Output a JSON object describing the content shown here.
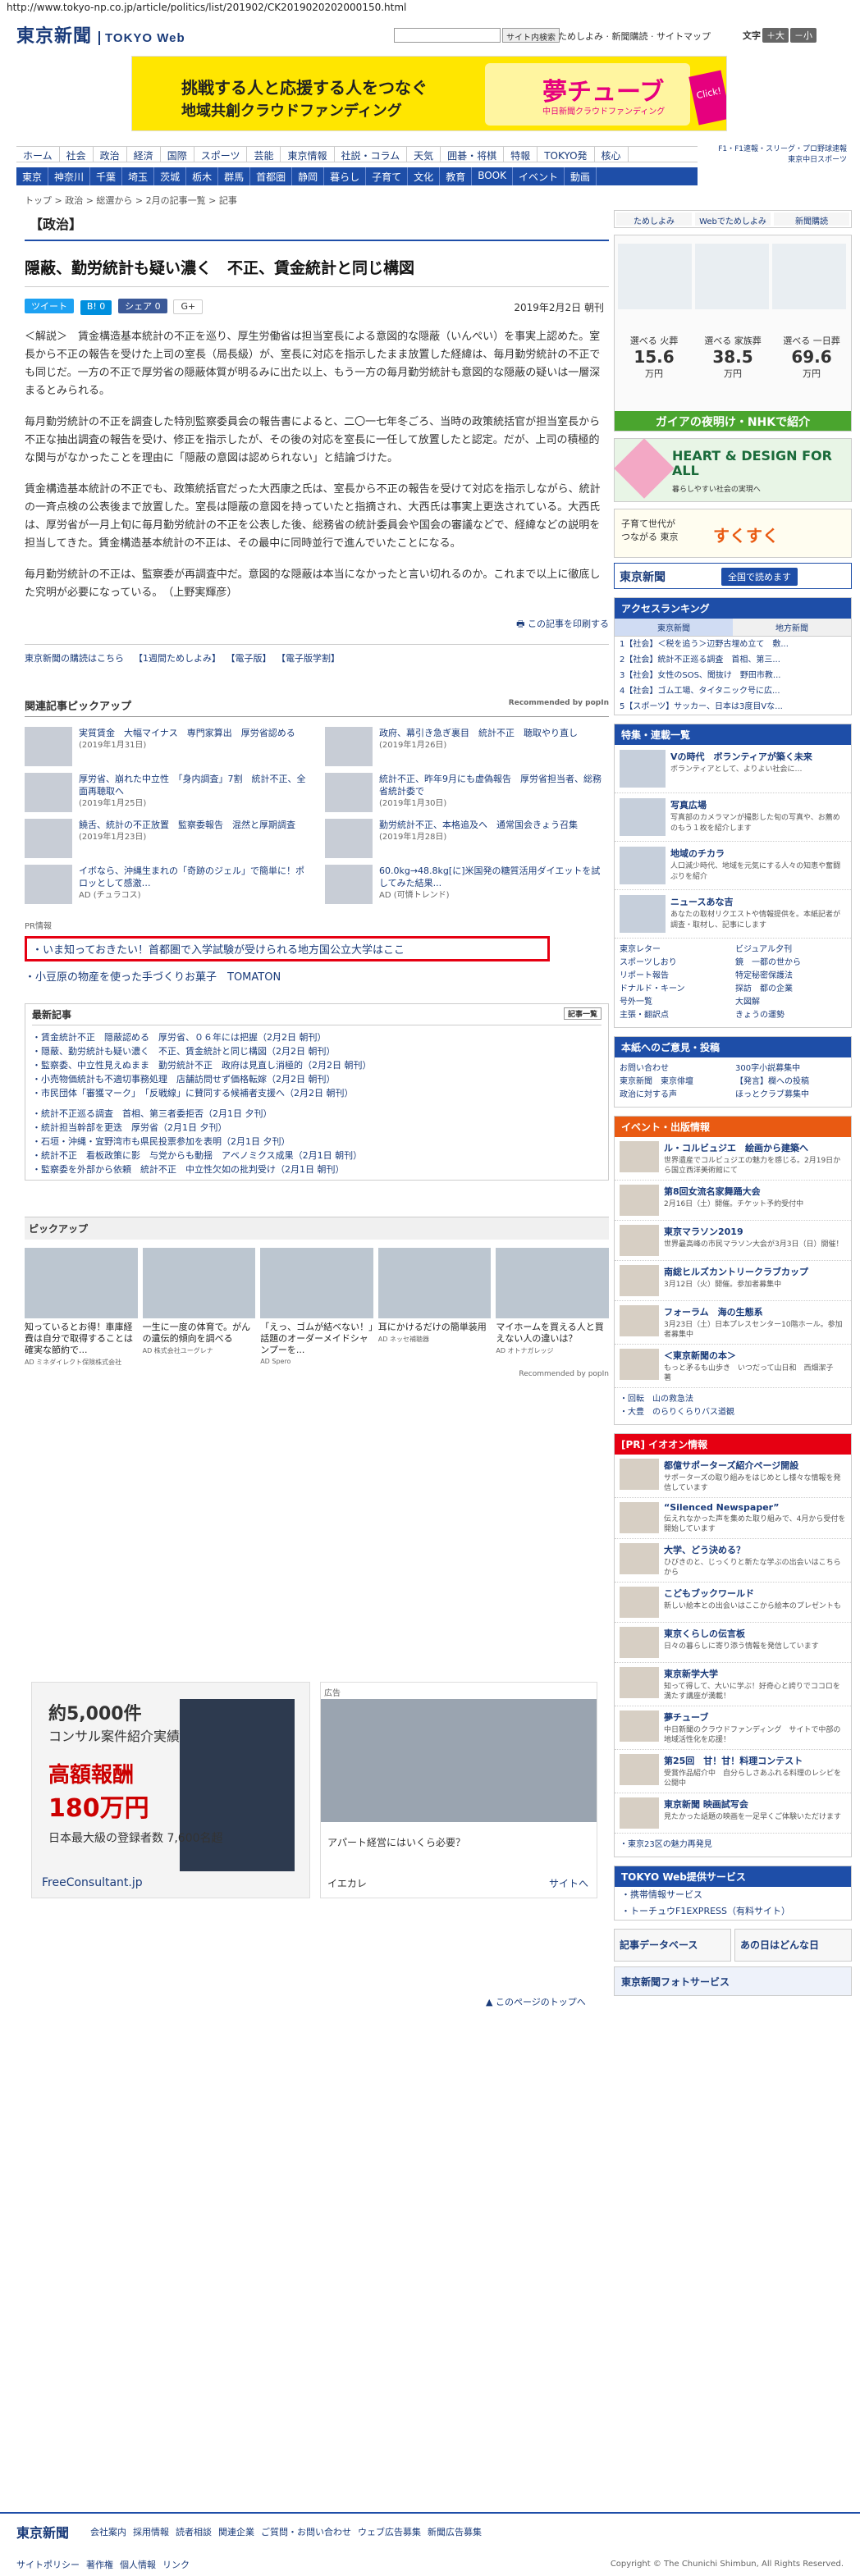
{
  "url": "http://www.tokyo-np.co.jp/article/politics/list/201902/CK2019020202000150.html",
  "header": {
    "logo": "東京新聞",
    "logo_web": "TOKYO Web",
    "search_btn": "サイト内検索",
    "links": "ためしよみ · 新聞購読 · サイトマップ",
    "font_label": "文字",
    "font_plus": "＋大",
    "font_minus": "－小"
  },
  "banner": {
    "line1": "挑戦する人と応援する人をつなぐ",
    "line2": "地域共創クラウドファンディング",
    "brand": "夢チューブ",
    "brand_sub": "中日新聞クラウドファンディング",
    "click": "Click!"
  },
  "gnav": [
    "ホーム",
    "社会",
    "政治",
    "経済",
    "国際",
    "スポーツ",
    "芸能",
    "東京情報",
    "社説・コラム",
    "天気",
    "囲碁・将棋",
    "特報",
    "TOKYO発",
    "核心"
  ],
  "gnav2": [
    "東京",
    "神奈川",
    "千葉",
    "埼玉",
    "茨城",
    "栃木",
    "群馬",
    "首都圏",
    "静岡",
    "暮らし",
    "子育て",
    "文化",
    "教育",
    "BOOK",
    "イベント",
    "動画"
  ],
  "header_right": [
    "F1・F1速報・スリーグ・プロ野球速報",
    "東京中日スポーツ"
  ],
  "breadcrumb": "トップ > 政治 > 総選から > 2月の記事一覧 > 記事",
  "section": "【政治】",
  "article": {
    "title": "隠蔽、勤労統計も疑い濃く　不正、賃金統計と同じ構図",
    "share": [
      "ツイート",
      "B! 0",
      "シェア 0",
      "G+"
    ],
    "date": "2019年2月2日 朝刊",
    "paras": [
      "＜解説＞　賃金構造基本統計の不正を巡り、厚生労働省は担当室長による意図的な隠蔽（いんぺい）を事実上認めた。室長から不正の報告を受けた上司の室長（局長級）が、室長に対応を指示したまま放置した経緯は、毎月勤労統計の不正でも同じだ。一方の不正で厚労省の隠蔽体質が明るみに出た以上、もう一方の毎月勤労統計も意図的な隠蔽の疑いは一層深まるとみられる。",
      "毎月勤労統計の不正を調査した特別監察委員会の報告書によると、二〇一七年冬ごろ、当時の政策統括官が担当室長から不正な抽出調査の報告を受け、修正を指示したが、その後の対応を室長に一任して放置したと認定。だが、上司の積極的な関与がなかったことを理由に「隠蔽の意図は認められない」と結論づけた。",
      "賃金構造基本統計の不正でも、政策統括官だった大西康之氏は、室長から不正の報告を受けて対応を指示しながら、統計の一斉点検の公表後まで放置した。室長は隠蔽の意図を持っていたと指摘され、大西氏は事実上更迭されている。大西氏は、厚労省が一月上旬に毎月勤労統計の不正を公表した後、総務省の統計委員会や国会の審議などで、経緯などの説明を担当してきた。賃金構造基本統計の不正は、その最中に同時並行で進んでいたことになる。",
      "毎月勤労統計の不正は、監察委が再調査中だ。意図的な隠蔽は本当になかったと言い切れるのか。これまで以上に徹底した究明が必要になっている。　（上野実輝彦）"
    ],
    "print": "この記事を印刷する"
  },
  "sublinks": [
    "東京新聞の購読はこちら",
    "【1週間ためしよみ】",
    "【電子版】",
    "【電子版学割】"
  ],
  "related": {
    "title": "関連記事ピックアップ",
    "powered": "Recommended by popIn",
    "items": [
      {
        "t": "実質賃金　大幅マイナス　専門家算出　厚労省認める",
        "d": "(2019年1月31日)"
      },
      {
        "t": "政府、幕引き急ぎ裏目　統計不正　聴取やり直し",
        "d": "(2019年1月26日)"
      },
      {
        "t": "厚労省、崩れた中立性　「身内調査」7割　統計不正、全面再聴取へ",
        "d": "(2019年1月25日)"
      },
      {
        "t": "統計不正、昨年9月にも虚偽報告　厚労省担当者、総務省統計委で",
        "d": "(2019年1月30日)"
      },
      {
        "t": "饒舌、統計の不正放置　監察委報告　混然と厚期調査",
        "d": "(2019年1月23日)"
      },
      {
        "t": "勤労統計不正、本格追及へ　通常国会きょう召集",
        "d": "(2019年1月28日)"
      },
      {
        "t": "イボなら、沖縄生まれの「奇跡のジェル」で簡単に！ポロッとして感激…",
        "d": "AD (チュラコス)"
      },
      {
        "t": "60.0kg→48.8kg[に]米国発の糖質活用ダイエットを試してみた結果...",
        "d": "AD (可憐トレンド)"
      }
    ]
  },
  "pr": {
    "label": "PR情報",
    "box": "・いま知っておきたい！首都圏で入学試験が受けられる地方国公立大学はここ",
    "line2": "・小豆原の物産を使った手づくりお菓子　TOMATON"
  },
  "latest": {
    "title": "最新記事",
    "btn": "記事一覧",
    "items": [
      "・賃金統計不正　隠蔽認める　厚労省、０６年には把握（2月2日 朝刊）",
      "・隠蔽、勤労統計も疑い濃く　不正、賃金統計と同じ構図（2月2日 朝刊）",
      "・監察委、中立性見えぬまま　勤労統計不正　政府は見直し消極的（2月2日 朝刊）",
      "・小売物価統計も不適切事務処理　店舗訪問せず価格転嫁（2月2日 朝刊）",
      "・市民団体「審獲マーク」　「反戦線」に賛同する候補者支援へ（2月2日 朝刊）",
      "",
      "・統計不正巡る調査　首相、第三者委拒否（2月1日 夕刊）",
      "・統計担当幹部を更迭　厚労省（2月1日 夕刊）",
      "・石垣・沖縄・宜野湾市も県民投票参加を表明（2月1日 夕刊）",
      "・統計不正　看板政策に影　与党からも動揺　アベノミクス成果（2月1日 朝刊）",
      "・監察委を外部から依頼　統計不正　中立性欠如の批判受け（2月1日 朝刊）"
    ]
  },
  "pickup": {
    "title": "ピックアップ",
    "cards": [
      {
        "t": "知っているとお得！車庫経費は自分で取得することは確実な節約で...",
        "ad": "AD ミネダイレクト保険株式会社"
      },
      {
        "t": "一生に一度の体育で。がんの遺伝的傾向を調べる",
        "ad": "AD 株式会社ユーグレナ"
      },
      {
        "t": "「えっ、ゴムが結べない！」話題のオーダーメイドシャンプーを...",
        "ad": "AD Spero"
      },
      {
        "t": "耳にかけるだけの簡単装用",
        "ad": "AD ネッセ補聴器"
      },
      {
        "t": "マイホームを買える人と買えない人の違いは？",
        "ad": "AD オトナガレッジ"
      }
    ],
    "powered": "Recommended by popIn"
  },
  "ad_left": {
    "a": "約5,000件",
    "b": "コンサル案件紹介実績",
    "c": "高額報酬",
    "d": "180万円",
    "e": "日本最大級の登録者数 7,600名超",
    "f": "FreeConsultant.jp"
  },
  "ad_right": {
    "tag": "広告",
    "cap": "アパート経営にはいくら必要？",
    "logo": "イエカレ",
    "site": "サイトへ"
  },
  "pagetop": "▲ このページのトップへ",
  "side": {
    "btns": [
      "ためしよみ",
      "Webでためしよみ",
      "新聞購読"
    ],
    "funeral": [
      {
        "l": "選べる 火葬",
        "v": "15.6",
        "u": "万円"
      },
      {
        "l": "選べる 家族葬",
        "v": "38.5",
        "u": "万円"
      },
      {
        "l": "選べる 一日葬",
        "v": "69.6",
        "u": "万円"
      }
    ],
    "gaia": "ガイアの夜明け・NHKで紹介",
    "hd_title": "HEART & DESIGN FOR ALL",
    "hd_sub": "暮らしやすい社会の実現へ",
    "suku_a": "子育て世代が",
    "suku_b": "つながる 東京",
    "suku_c": "すくすく",
    "tk": "東京新聞",
    "tk_btn": "全国で読めます",
    "ranking": {
      "title": "アクセスランキング",
      "tabs": [
        "東京新聞",
        "地方新聞"
      ],
      "items": [
        "1【社会】＜税を追う＞辺野古埋め立て　敷...",
        "2【社会】統計不正巡る調査　首相、第三...",
        "3【社会】女性のSOS、聞抜け　野田市教...",
        "4【社会】ゴム工場、タイタニック号に広...",
        "5【スポーツ】サッカー、日本は3度目Vな..."
      ]
    },
    "feat": {
      "title": "特集・連載一覧",
      "items": [
        {
          "t": "Vの時代　ボランティアが築く未来",
          "s": "ボランティアとして、よりよい社会に…"
        },
        {
          "t": "写真広場",
          "s": "写真部のカメラマンが撮影した旬の写真や、お薦めのもう１枚を紹介します"
        },
        {
          "t": "地域のチカラ",
          "s": "人口減少時代、地域を元気にする人々の知恵や奮闘ぶりを紹介"
        },
        {
          "t": "ニュースあな吉",
          "s": "あなたの取材リクエストや情報提供を。本紙記者が調査・取材し、記事にします"
        }
      ],
      "grid": [
        "東京レター",
        "ビジュアル夕刊",
        "スポーツしおり",
        "鏡　一都の世から",
        "リポート報告",
        "特定秘密保護法",
        "ドナルド・キーン",
        "探訪　都の企業",
        "号外一覧",
        "大図解",
        "主張・翻訳点",
        "きょうの運勢"
      ]
    },
    "corp": {
      "title": "本紙へのご意見・投稿",
      "grid": [
        "お問い合わせ",
        "300字小説募集中",
        "東京新聞　東京俳壇",
        "【発言】欄への投稿",
        "政治に対する声",
        "ほっとクラブ募集中"
      ]
    },
    "event": {
      "title": "イベント・出版情報",
      "items": [
        {
          "t": "ル・コルビュジエ　絵画から建築へ",
          "s": "世界遺産でコルビュジエの魅力を感じる。2月19日から国立西洋美術館にて"
        },
        {
          "t": "第8回女流名家舞踊大会",
          "s": "2月16日（土）開催。チケット予約受付中"
        },
        {
          "t": "東京マラソン2019",
          "s": "世界最高峰の市民マラソン大会が3月3日（日）開催！"
        },
        {
          "t": "南総ヒルズカントリークラブカップ",
          "s": "3月12日（火）開催。参加者募集中"
        },
        {
          "t": "フォーラム　海の生態系",
          "s": "3月23日（土）日本プレスセンター10階ホール。参加者募集中"
        },
        {
          "t": "＜東京新聞の本＞",
          "s": "もっと矛るも山歩き　いつだって山日和　西畑潔子　著"
        }
      ],
      "links": [
        "・回転　山の救急法",
        "・大豊　のらりくらりバス道観"
      ]
    },
    "iif": {
      "title": "[PR] イオオン情報",
      "items": [
        {
          "t": "都億サポーターズ紹介ページ開設",
          "s": "サポーターズの取り組みをはじめとし様々な情報を発信しています"
        },
        {
          "t": "“Silenced Newspaper”",
          "s": "伝えれなかった声を集めた取り組みで、4月から受付を開始しています"
        },
        {
          "t": "大学、どう決める？",
          "s": "ひびきのと、じっくりと新たな学ぶの出会いはこちらから"
        },
        {
          "t": "こどもブックワールド",
          "s": "新しい絵本との出会いはここから絵本のプレゼントも"
        },
        {
          "t": "東京くらしの伝言板",
          "s": "日々の暮らしに寄り添う情報を発信しています"
        },
        {
          "t": "東京新学大学",
          "s": "知って得して、大いに学ぶ！好奇心と誇りでココロを満たす講座が満載！"
        },
        {
          "t": "夢チューブ",
          "s": "中日新聞のクラウドファンディング　サイトで中部の地域活性化を応援！"
        },
        {
          "t": "第25回　甘！甘！料理コンテスト",
          "s": "受賞作品紹介中　自分らしさあふれる料理のレシピを公開中"
        },
        {
          "t": "東京新聞 映画試写会",
          "s": "見たかった話題の映画を一足早くご体験いただけます"
        }
      ],
      "link": "・東京23区の魅力再発見"
    },
    "svc": {
      "title": "TOKYO Web提供サービス",
      "items": [
        "・携帯情報サービス",
        "・トーチュウF1EXPRESS（有料サイト）"
      ]
    },
    "bot1": "記事データベース",
    "bot2": "あの日はどんな日",
    "bot3": "東京新聞フォトサービス"
  },
  "footer": {
    "logo": "東京新聞",
    "links": [
      "会社案内",
      "採用情報",
      "読者相談",
      "関連企業",
      "ご質問・お問い合わせ",
      "ウェブ広告募集",
      "新聞広告募集"
    ],
    "links2": [
      "サイトポリシー",
      "著作権",
      "個人情報",
      "リンク"
    ],
    "copy": "Copyright © The Chunichi Shimbun, All Rights Reserved."
  },
  "colors": {
    "brand": "#1e4ea8",
    "accent_red": "#e60012",
    "gaia_green": "#4aa52e"
  }
}
